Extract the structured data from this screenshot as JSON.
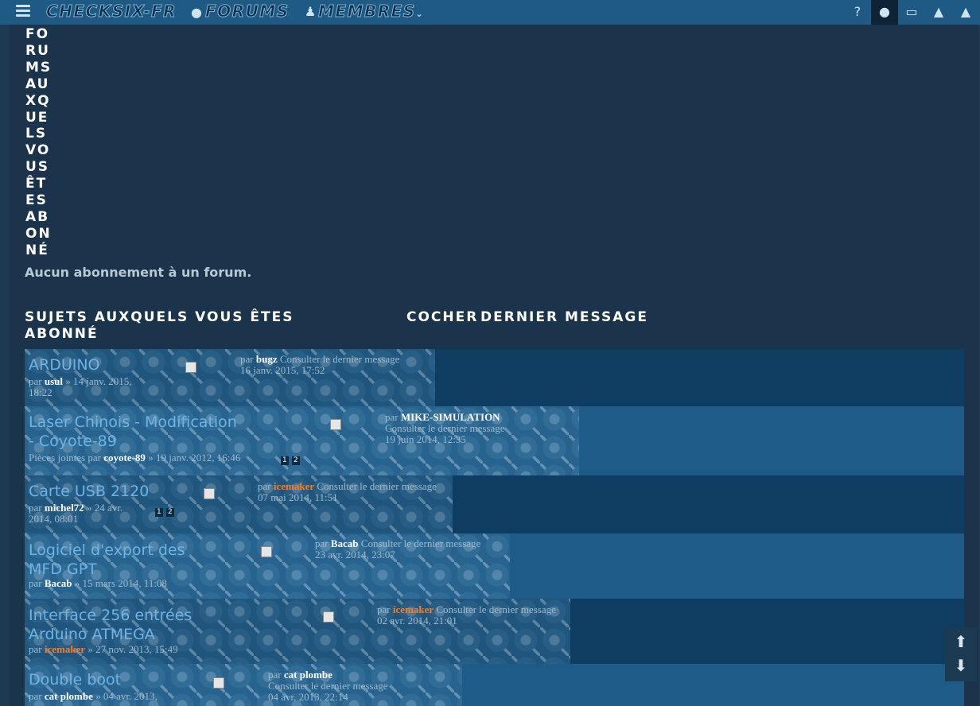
{
  "nav": {
    "site_title": "CHECKSIX-FR",
    "forums_label": "FORUMS",
    "members_label": "MEMBRES",
    "icons": [
      "menu-icon",
      "comment-icon",
      "users-icon",
      "chevron-down-icon",
      "question-icon",
      "user-icon",
      "inbox-icon",
      "bell-icon"
    ]
  },
  "page": {
    "title": "Forums auxquels vous êtes abonné",
    "no_forum": "Aucun abonnement à un forum.",
    "col_topics": "Sujets auxquels vous êtes abonné",
    "col_check": "Cocher",
    "col_last": "Dernier message"
  },
  "common": {
    "par": "par",
    "consult": "Consulter le dernier message",
    "sep": "»",
    "pj": "Pièces jointes par"
  },
  "topics": [
    {
      "title": "ARDUINO",
      "author": "usul",
      "date": "14 janv. 2015, 18:22",
      "last_author": "bugz",
      "last_date": "16 janv. 2015, 17:52"
    },
    {
      "title": "Laser Chinois - Modification - Coyote-89",
      "author": "coyote-89",
      "date": "19 janv. 2012, 16:46",
      "last_author": "MIKE-SIMULATION",
      "last_date": "19 juin 2014, 12:35",
      "pages": [
        "1",
        "2"
      ]
    },
    {
      "title": "Carte USB 2120",
      "author": "michel72",
      "date": "24 avr. 2014, 08:01",
      "last_author": "icemaker",
      "last_date": "07 mai 2014, 11:51",
      "pages": [
        "1",
        "2"
      ]
    },
    {
      "title": "Logiciel d'export des MFD GPT",
      "author": "Bacab",
      "date": "15 mars 2014, 11:08",
      "last_author": "Bacab",
      "last_date": "23 avr. 2014, 23:07"
    },
    {
      "title": "Interface 256 entrées Arduino ATMEGA",
      "author": "icemaker",
      "date": "27 nov. 2013, 15:49",
      "last_author": "icemaker",
      "last_date": "02 avr. 2014, 21:01"
    },
    {
      "title": "Double boot",
      "author": "cat plombe",
      "date": "04 avr. 2013,",
      "last_author": "cat plombe",
      "last_date": "04 avr. 2013, 22:14"
    }
  ],
  "colors": {
    "navbar": "#1f5a84",
    "body": "#1b344b",
    "row_dark": "#0f3d62",
    "row_light": "#1f5b88",
    "link": "#6fb3e6",
    "highlight_user": "#ff7a1a"
  }
}
